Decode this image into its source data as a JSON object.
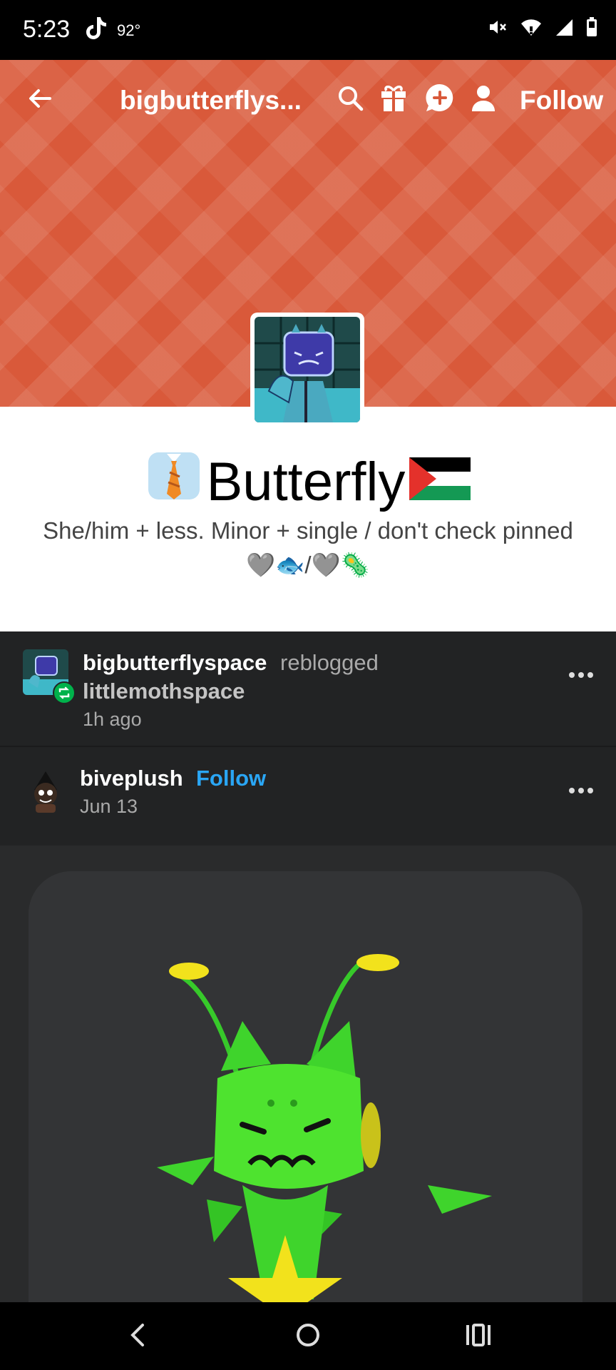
{
  "status_bar": {
    "time": "5:23",
    "temperature": "92°",
    "icons": [
      "tiktok-icon",
      "mute-icon",
      "wifi-icon",
      "signal-icon",
      "battery-icon"
    ]
  },
  "header": {
    "blog_name": "bigbutterflys...",
    "follow_label": "Follow",
    "accent_color": "#d9593a"
  },
  "profile": {
    "title": "Butterfly",
    "bio": "She/him + less. Minor + single / don't check pinned 🩶🐟/🩶🦠"
  },
  "reblog": {
    "reblogger": "bigbutterflyspace",
    "action": "reblogged",
    "source": "littlemothspace",
    "time": "1h ago"
  },
  "post": {
    "author": "biveplush",
    "follow_label": "Follow",
    "date": "Jun 13"
  }
}
